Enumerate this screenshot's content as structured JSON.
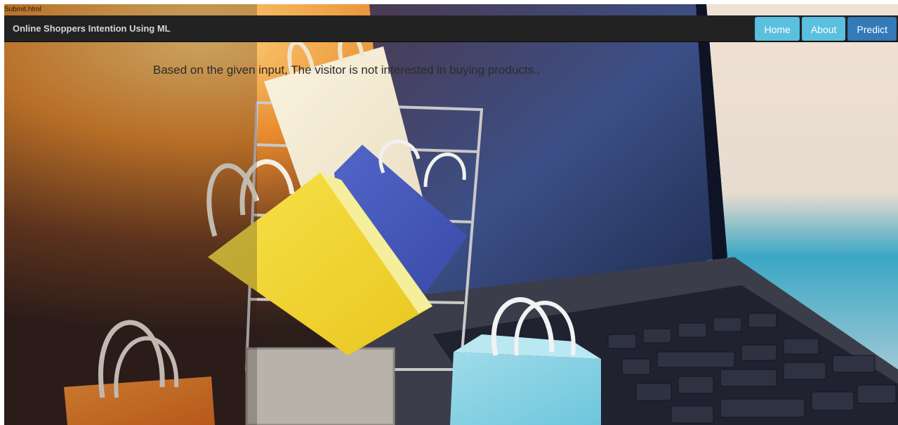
{
  "window": {
    "file_label": "Submit.html"
  },
  "navbar": {
    "brand": "Online Shoppers Intention Using ML",
    "buttons": [
      {
        "label": "Home",
        "color": "#5bc0de"
      },
      {
        "label": "About",
        "color": "#5bc0de"
      },
      {
        "label": "Predict",
        "color": "#337ab7"
      }
    ]
  },
  "main": {
    "result_text": "Based on the given input, The visitor is not interested in buying products.."
  },
  "background": {
    "description_icon": "shopping-bags-cart-laptop-image"
  }
}
